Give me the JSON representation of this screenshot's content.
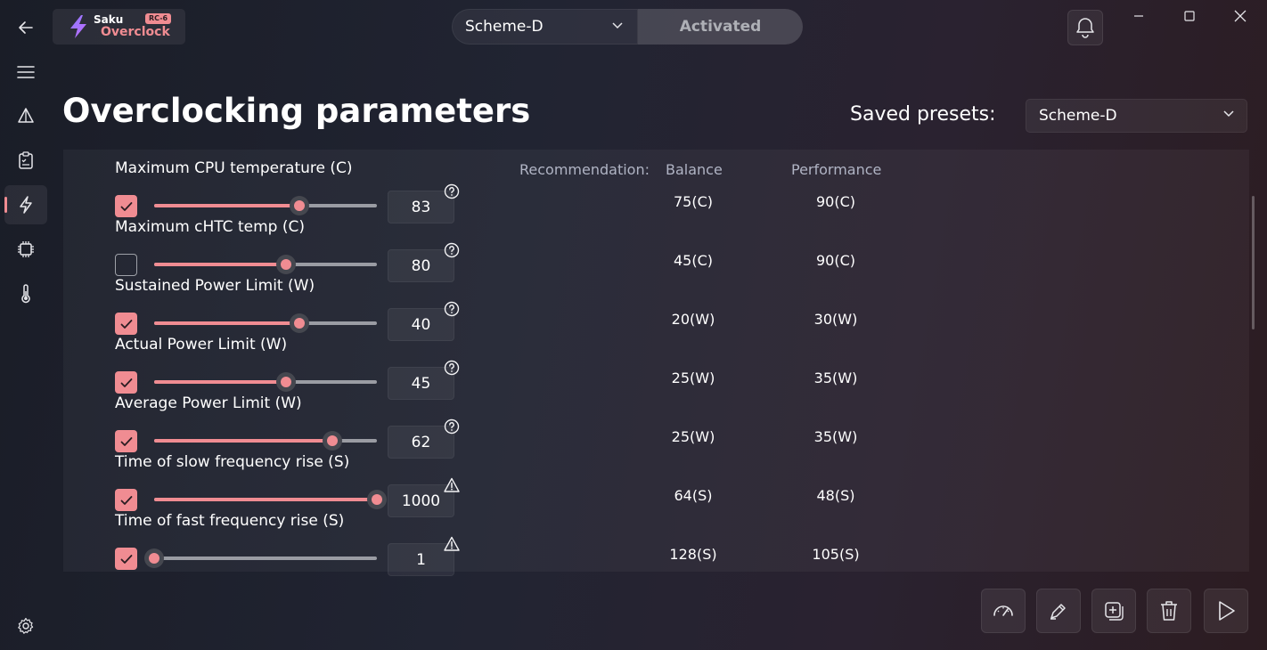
{
  "app": {
    "logo_name": "Saku",
    "logo_product": "Overclock",
    "logo_badge": "RC-6",
    "accent_color": "#f08c92"
  },
  "sidebar": {
    "items": [
      {
        "icon": "back-arrow-icon"
      },
      {
        "icon": "menu-icon"
      },
      {
        "icon": "triangle-warning-icon"
      },
      {
        "icon": "clipboard-icon"
      },
      {
        "icon": "lightning-icon",
        "active": true
      },
      {
        "icon": "chip-icon"
      },
      {
        "icon": "thermometer-icon"
      },
      {
        "icon": "settings-gear-icon"
      }
    ]
  },
  "header": {
    "scheme_value": "Scheme-D",
    "activated_label": "Activated"
  },
  "page": {
    "title": "Overclocking parameters",
    "presets_label": "Saved presets:",
    "presets_value": "Scheme-D"
  },
  "recommendation": {
    "heading": "Recommendation:",
    "balance_heading": "Balance",
    "performance_heading": "Performance"
  },
  "params": [
    {
      "label": "Maximum CPU temperature (C)",
      "checked": true,
      "value": "83",
      "level": 0.65,
      "hint": "help",
      "balance": "75(C)",
      "performance": "90(C)"
    },
    {
      "label": "Maximum cHTC temp (C)",
      "checked": false,
      "value": "80",
      "level": 0.59,
      "hint": "help",
      "balance": "45(C)",
      "performance": "90(C)"
    },
    {
      "label": "Sustained Power Limit (W)",
      "checked": true,
      "value": "40",
      "level": 0.65,
      "hint": "help",
      "balance": "20(W)",
      "performance": "30(W)"
    },
    {
      "label": "Actual Power Limit (W)",
      "checked": true,
      "value": "45",
      "level": 0.59,
      "hint": "help",
      "balance": "25(W)",
      "performance": "35(W)"
    },
    {
      "label": "Average Power Limit (W)",
      "checked": true,
      "value": "62",
      "level": 0.8,
      "hint": "help",
      "balance": "25(W)",
      "performance": "35(W)"
    },
    {
      "label": "Time of slow frequency rise (S)",
      "checked": true,
      "value": "1000",
      "level": 1.0,
      "hint": "warning",
      "balance": "64(S)",
      "performance": "48(S)"
    },
    {
      "label": "Time of fast frequency rise (S)",
      "checked": true,
      "value": "1",
      "level": 0.0,
      "hint": "warning",
      "balance": "128(S)",
      "performance": "105(S)"
    }
  ],
  "toolbar": [
    {
      "icon": "speedometer-icon"
    },
    {
      "icon": "edit-pen-icon"
    },
    {
      "icon": "add-preset-icon"
    },
    {
      "icon": "trash-icon"
    },
    {
      "icon": "play-icon"
    }
  ]
}
